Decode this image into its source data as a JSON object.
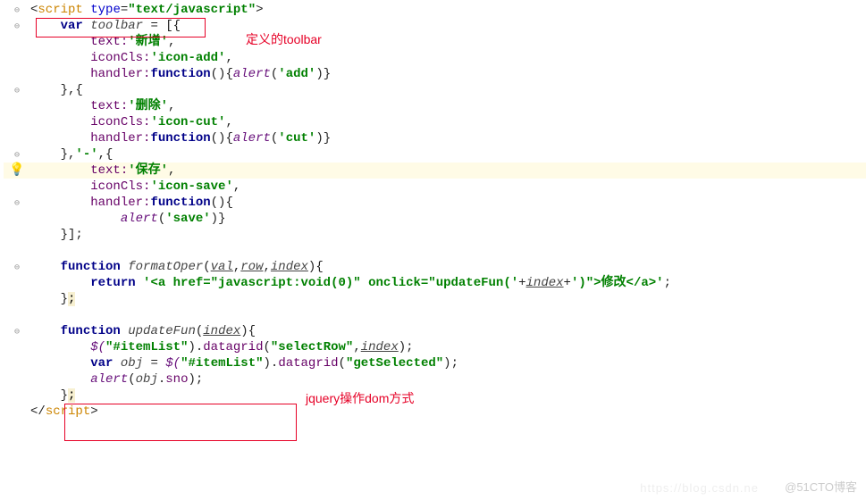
{
  "script_open": {
    "tag": "script",
    "attr": "type",
    "val": "text/javascript"
  },
  "toolbar_decl": {
    "kw": "var",
    "name": "toolbar",
    "eq": " = [{"
  },
  "note1": "定义的toolbar",
  "items": [
    {
      "text_k": "text:",
      "text_v": "'新增'",
      "cls_k": "iconCls:",
      "cls_v": "'icon-add'",
      "h_k": "handler:",
      "h_fn": "function",
      "h_body": "alert",
      "h_arg": "'add'"
    },
    {
      "sep": "},{"
    },
    {
      "text_k": "text:",
      "text_v": "'删除'",
      "cls_k": "iconCls:",
      "cls_v": "'icon-cut'",
      "h_k": "handler:",
      "h_fn": "function",
      "h_body": "alert",
      "h_arg": "'cut'"
    },
    {
      "sep2_a": "},",
      "sep2_b": "'-'",
      "sep2_c": ",{"
    },
    {
      "text_k": "text:",
      "text_v": "'保存'",
      "cls_k": "iconCls:",
      "cls_v": "'icon-save'",
      "h_k": "handler:",
      "h_fn": "function",
      "h_body": "alert",
      "h_arg": "'save'"
    }
  ],
  "arr_close": "}];",
  "fn1": {
    "kw": "function",
    "name": "formatOper",
    "p1": "val",
    "p2": "row",
    "p3": "index"
  },
  "fn1_ret": {
    "kw": "return",
    "s1": "'<a href=\"javascript:void(0)\" onclick=\"updateFun('",
    "plus": "+",
    "p": "index",
    "s2": "')\">修改</a>'"
  },
  "close_brace": "}",
  "semi": ";",
  "fn2": {
    "kw": "function",
    "name": "updateFun",
    "p": "index"
  },
  "note2": "jquery操作dom方式",
  "l1": {
    "jq": "$(",
    "sel": "\"#itemList\"",
    "dot": ").",
    "m": "datagrid",
    "a1": "\"selectRow\"",
    "c": ",",
    "a2": "index",
    "end": ");"
  },
  "l2": {
    "kw": "var",
    "obj": "obj",
    "eq": " = ",
    "jq": "$(",
    "sel": "\"#itemList\"",
    "dot": ")",
    "dot2": ".",
    "m": "datagrid",
    "a": "\"getSelected\"",
    "end": ");"
  },
  "l3": {
    "fn": "alert",
    "a": "obj",
    "dot": ".",
    "p": "sno",
    "end": ");"
  },
  "script_close": "script",
  "wm": "@51CTO博客",
  "wm2": "https://blog.csdn.ne",
  "chart_data": null
}
